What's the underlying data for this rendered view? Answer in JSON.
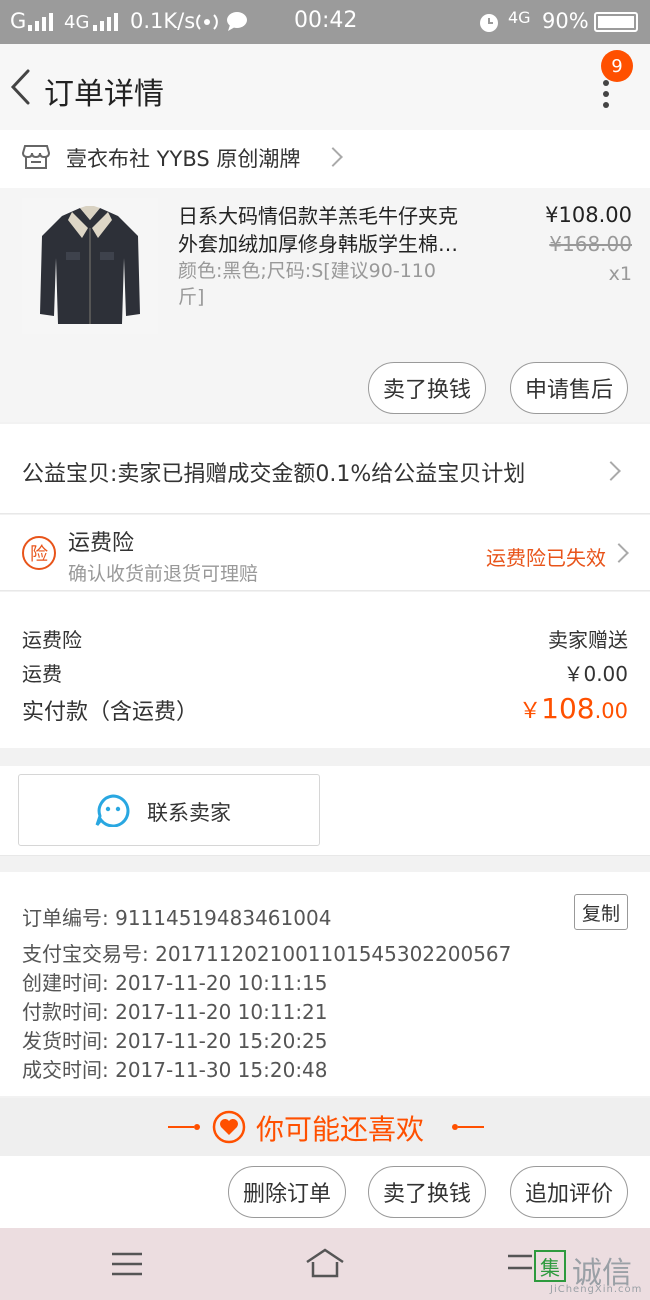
{
  "status_bar": {
    "carrier": "G",
    "network": "4G",
    "speed": "0.1K/s",
    "time": "00:42",
    "network2": "4G",
    "battery": "90%"
  },
  "header": {
    "title": "订单详情",
    "badge_count": "9"
  },
  "shop": {
    "name": "壹衣布社 YYBS 原创潮牌"
  },
  "product": {
    "title": "日系大码情侣款羊羔毛牛仔夹克外套加绒加厚修身韩版学生棉…",
    "title_line1": "日系大码情侣款羊羔毛牛仔夹克",
    "title_line2": "外套加绒加厚修身韩版学生棉…",
    "spec_line1": "颜色:黑色;尺码:S[建议90-110",
    "spec_line2": "斤]",
    "price": "¥108.00",
    "original_price": "¥168.00",
    "quantity": "x1",
    "sell_button": "卖了换钱",
    "aftersale_button": "申请售后"
  },
  "charity": {
    "text": "公益宝贝:卖家已捐赠成交金额0.1%给公益宝贝计划"
  },
  "insurance": {
    "icon_char": "险",
    "title": "运费险",
    "subtitle": "确认收货前退货可理赔",
    "status": "运费险已失效",
    "status_color": "#e8541a"
  },
  "summary": {
    "rows": [
      {
        "label": "运费险",
        "value": "卖家赠送"
      },
      {
        "label": "运费",
        "value": "￥0.00"
      }
    ],
    "total_label": "实付款（含运费）",
    "total_symbol": "￥",
    "total_int": "108",
    "total_dec": ".00",
    "accent_color": "#ff5000"
  },
  "contact": {
    "label": "联系卖家"
  },
  "order_info": {
    "copy_button": "复制",
    "lines": [
      "订单编号: 91114519483461004",
      "支付宝交易号: 2017112021001101545302200567",
      "创建时间: 2017-11-20 10:11:15",
      "付款时间: 2017-11-20 10:11:21",
      "发货时间: 2017-11-20 15:20:25",
      "成交时间: 2017-11-30 15:20:48"
    ]
  },
  "recommend": {
    "label": "你可能还喜欢"
  },
  "actions": {
    "delete": "删除订单",
    "sell": "卖了换钱",
    "review": "追加评价"
  },
  "watermark": {
    "char": "集",
    "text": "诚信",
    "domain": "JiChengXin.com"
  },
  "icons": [
    "back-arrow-icon",
    "more-icon",
    "shop-icon",
    "chevron-right-icon",
    "insurance-icon",
    "chat-face-icon",
    "heart-icon",
    "menu-icon",
    "home-icon",
    "back-icon"
  ]
}
